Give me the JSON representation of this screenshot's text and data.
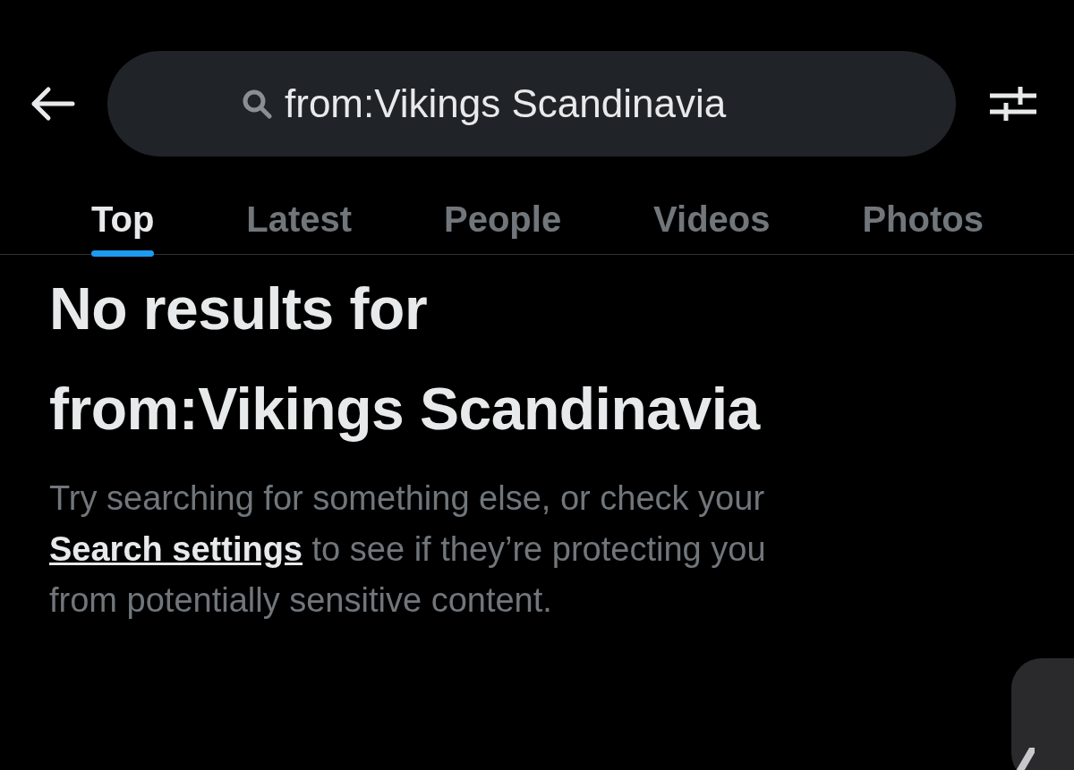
{
  "search": {
    "value": "from:Vikings Scandinavia"
  },
  "tabs": [
    {
      "label": "Top",
      "selected": true
    },
    {
      "label": "Latest",
      "selected": false
    },
    {
      "label": "People",
      "selected": false
    },
    {
      "label": "Videos",
      "selected": false
    },
    {
      "label": "Photos",
      "selected": false
    }
  ],
  "empty_state": {
    "title_lines": [
      "No results for",
      "from:Vikings Scandinavia"
    ],
    "message_before": "Try searching for something else, or check your",
    "link": "Search settings",
    "message_after": "to see if they’re protecting you from potentially sensitive content."
  }
}
